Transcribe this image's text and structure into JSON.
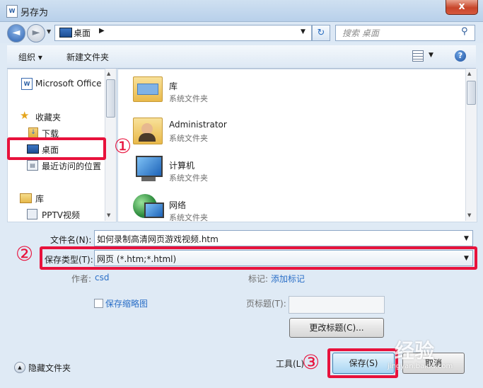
{
  "window": {
    "title": "另存为",
    "close": "x"
  },
  "address": {
    "location": "桌面",
    "search_placeholder": "搜索 桌面"
  },
  "toolbar": {
    "organize": "组织 ▾",
    "new_folder": "新建文件夹"
  },
  "nav": {
    "items": [
      {
        "label": "Microsoft Office",
        "icon": "office-icon"
      },
      {
        "label": "收藏夹",
        "icon": "star-icon"
      },
      {
        "label": "下载",
        "icon": "download-icon"
      },
      {
        "label": "桌面",
        "icon": "desktop-icon"
      },
      {
        "label": "最近访问的位置",
        "icon": "recent-places-icon"
      },
      {
        "label": "库",
        "icon": "library-icon"
      },
      {
        "label": "PPTV视频",
        "icon": "video-folder-icon"
      }
    ]
  },
  "files": [
    {
      "name": "库",
      "type": "系统文件夹",
      "icon": "library-folder-icon"
    },
    {
      "name": "Administrator",
      "type": "系统文件夹",
      "icon": "user-folder-icon"
    },
    {
      "name": "计算机",
      "type": "系统文件夹",
      "icon": "computer-icon"
    },
    {
      "name": "网络",
      "type": "系统文件夹",
      "icon": "network-icon"
    }
  ],
  "form": {
    "filename_label": "文件名(N):",
    "filename_value": "如何录制高清网页游戏视频.htm",
    "savetype_label": "保存类型(T):",
    "savetype_value": "网页 (*.htm;*.html)",
    "author_label": "作者:",
    "author_value": "csd",
    "tags_label": "标记:",
    "tags_value": "添加标记",
    "thumbnail_label": "保存缩略图",
    "pagetitle_label": "页标题(T):",
    "change_title_button": "更改标题(C)...",
    "hide_folders": "隐藏文件夹",
    "tools": "工具(L)",
    "save": "保存(S)",
    "cancel": "取消"
  },
  "annotations": {
    "one": "①",
    "two": "②",
    "three": "③"
  },
  "watermark": {
    "text": "经验",
    "sub": "jingyan.baidu.com"
  },
  "colors": {
    "annotation_red": "#e8123c",
    "link_blue": "#2a6fc7",
    "title_bar": "#c5d9ef"
  }
}
